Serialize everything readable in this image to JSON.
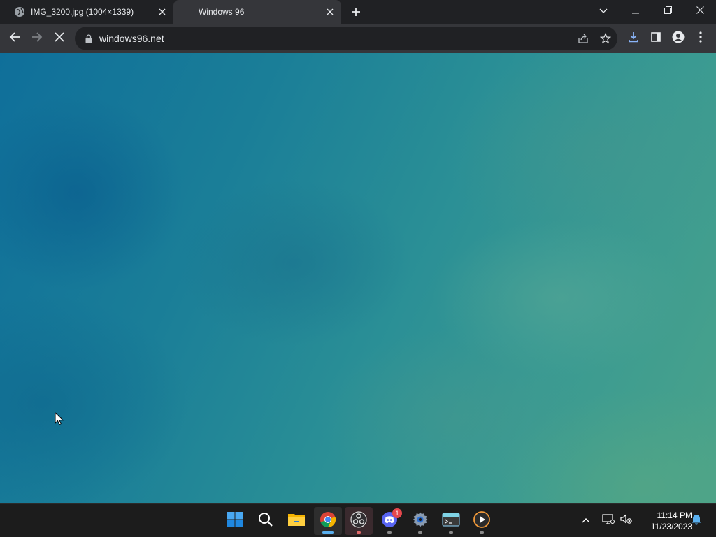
{
  "browser": {
    "tabs": [
      {
        "title": "IMG_3200.jpg (1004×1339)",
        "active": false,
        "favicon": "globe-icon"
      },
      {
        "title": "Windows 96",
        "active": true,
        "favicon": "loading-icon"
      }
    ],
    "address_bar": {
      "url": "windows96.net",
      "secure": true
    }
  },
  "page": {
    "background": "teal-blue cloudy wallpaper",
    "accent_colors": [
      "#0f6f9a",
      "#2a8f96",
      "#4aa38a"
    ]
  },
  "taskbar": {
    "apps": [
      {
        "name": "Start",
        "icon": "windows-start-icon"
      },
      {
        "name": "Search",
        "icon": "search-icon"
      },
      {
        "name": "File Explorer",
        "icon": "folder-icon"
      },
      {
        "name": "Google Chrome",
        "icon": "chrome-icon",
        "active": true
      },
      {
        "name": "OBS Studio",
        "icon": "obs-icon",
        "running": true
      },
      {
        "name": "Discord",
        "icon": "discord-icon",
        "badge": "1",
        "running": true
      },
      {
        "name": "Settings",
        "icon": "settings-gear-icon",
        "running": true
      },
      {
        "name": "Terminal",
        "icon": "terminal-icon",
        "running": true
      },
      {
        "name": "Media Player",
        "icon": "media-player-icon",
        "running": true
      }
    ],
    "clock": {
      "time": "11:14 PM",
      "date": "11/23/2023"
    }
  }
}
